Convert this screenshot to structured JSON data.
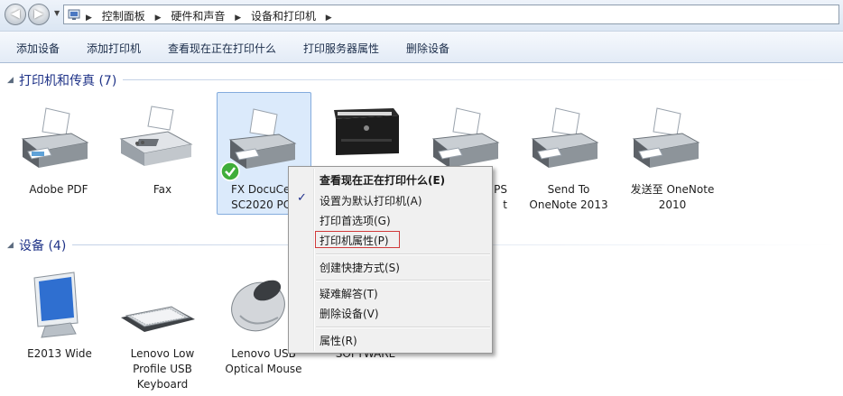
{
  "breadcrumb": [
    "控制面板",
    "硬件和声音",
    "设备和打印机"
  ],
  "commands": [
    "添加设备",
    "添加打印机",
    "查看现在正在打印什么",
    "打印服务器属性",
    "删除设备"
  ],
  "printers_group": {
    "title": "打印机和传真 (7)"
  },
  "printers": [
    "Adobe PDF",
    "Fax",
    "FX DocuCen\nSC2020 PCL",
    "",
    "PS\nt",
    "Send To\nOneNote 2013",
    "发送至 OneNote\n2010"
  ],
  "devices_group": {
    "title": "设备 (4)"
  },
  "devices": [
    "E2013 Wide",
    "Lenovo Low\nProfile USB\nKeyboard",
    "Lenovo USB\nOptical Mouse",
    "SOFTWARE"
  ],
  "context_menu": {
    "check_glyph": "✓",
    "items": [
      "查看现在正在打印什么(E)",
      "设置为默认打印机(A)",
      "打印首选项(G)",
      "打印机属性(P)",
      "创建快捷方式(S)",
      "疑难解答(T)",
      "删除设备(V)",
      "属性(R)"
    ]
  },
  "icons": {
    "back": "back-arrow-icon",
    "forward": "forward-arrow-icon",
    "location": "control-panel-icon",
    "default_printer": "green-check-icon"
  },
  "colors": {
    "group_title": "#1e3287",
    "selection": "#dbeafb",
    "highlight_border": "#d03a3a"
  }
}
